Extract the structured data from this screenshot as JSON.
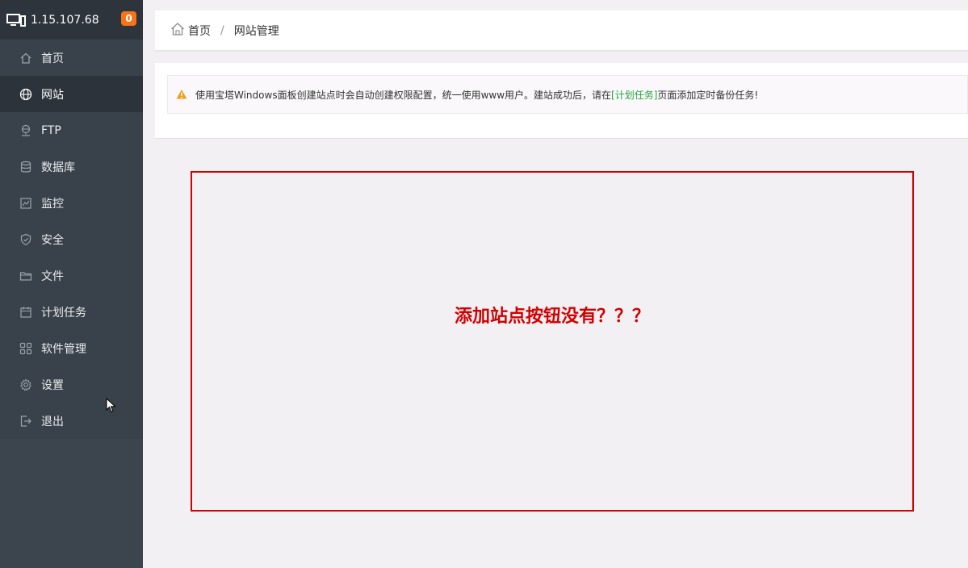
{
  "header": {
    "ip": "1.15.107.68",
    "badge_count": "0"
  },
  "sidebar": {
    "items": [
      {
        "label": "首页",
        "icon": "home-icon",
        "active": false
      },
      {
        "label": "网站",
        "icon": "globe-icon",
        "active": true
      },
      {
        "label": "FTP",
        "icon": "ftp-icon",
        "active": false
      },
      {
        "label": "数据库",
        "icon": "database-icon",
        "active": false
      },
      {
        "label": "监控",
        "icon": "monitor-chart-icon",
        "active": false
      },
      {
        "label": "安全",
        "icon": "shield-icon",
        "active": false
      },
      {
        "label": "文件",
        "icon": "folder-icon",
        "active": false
      },
      {
        "label": "计划任务",
        "icon": "calendar-icon",
        "active": false
      },
      {
        "label": "软件管理",
        "icon": "apps-grid-icon",
        "active": false
      },
      {
        "label": "设置",
        "icon": "gear-icon",
        "active": false
      },
      {
        "label": "退出",
        "icon": "logout-icon",
        "active": false
      }
    ]
  },
  "breadcrumb": {
    "home": "首页",
    "separator": "/",
    "current": "网站管理"
  },
  "notice": {
    "text_before": "使用宝塔Windows面板创建站点时会自动创建权限配置，统一使用www用户。建站成功后，请在",
    "link": "[计划任务]",
    "text_after": "页面添加定时备份任务!"
  },
  "annotation": {
    "text": "添加站点按钮没有？？？"
  },
  "colors": {
    "sidebar_bg": "#3c444d",
    "sidebar_active": "#2c333b",
    "badge": "#f7731a",
    "link_green": "#20a53a",
    "annotation_red": "#d20000",
    "warning": "#f0a020"
  }
}
